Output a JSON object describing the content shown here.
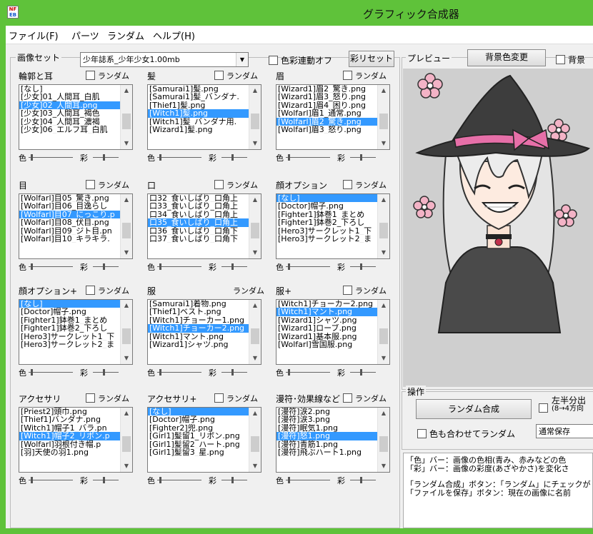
{
  "window": {
    "title": "グラフィック合成器"
  },
  "menu": {
    "items": [
      "ファイル(F)",
      "パーツ",
      "ランダム",
      "ヘルプ(H)"
    ]
  },
  "imageset": {
    "label": "画像セット",
    "value": "少年誌系_少年少女1.00mb",
    "color_link": "色彩連動オフ",
    "saturation_button": "彩リセット"
  },
  "preview": {
    "label": "プレビュー",
    "bgcolor_button": "背景色変更",
    "bg_check_label": "背景"
  },
  "parts": [
    {
      "name": "輪郭と耳",
      "random": "ランダム",
      "items": [
        "[なし]",
        "[少女]01_人間耳_白肌",
        "[少女]02_人間耳.png",
        "[少女]03_人間耳_褐色",
        "[少女]04_人間耳_濃褐",
        "[少女]06_エルフ耳_白肌"
      ],
      "selected": 2
    },
    {
      "name": "髪",
      "random": "ランダム",
      "items": [
        "[Samurai1]髪.png",
        "[Samurai1]髪_バンダナ.",
        "[Thief1]髪.png",
        "[Witch1]髪.png",
        "[Witch1]髪_バンダナ用.",
        "[Wizard1]髪.png"
      ],
      "selected": 3
    },
    {
      "name": "眉",
      "random": "ランダム",
      "items": [
        "[Wizard1]眉2_驚き.png",
        "[Wizard1]眉3_怒り.png",
        "[Wizard1]眉4_困り.png",
        "[Wolfarl]眉1_通常.png",
        "[Wolfarl]眉2_驚き.png",
        "[Wolfarl]眉3_怒り.png"
      ],
      "selected": 4
    },
    {
      "name": "目",
      "random": "ランダム",
      "items": [
        "[Wolfarl]目05_驚き.png",
        "[Wolfarl]目06_目逸らし",
        "[Wolfarl]目07_にっこり.p",
        "[Wolfarl]目08_伏目.png",
        "[Wolfarl]目09_ジト目.pn",
        "[Wolfarl]目10_キラキラ."
      ],
      "selected": 2
    },
    {
      "name": "口",
      "random": "ランダム",
      "items": [
        "口32_食いしばり_口角上",
        "口33_食いしばり_口角上",
        "口34_食いしばり_口角上",
        "口35_食いしばり_口角上",
        "口36_食いしばり_口角下",
        "口37_食いしばり_口角下"
      ],
      "selected": 3
    },
    {
      "name": "顔オプション",
      "random": "ランダム",
      "items": [
        "[なし]",
        "[Doctor]帽子.png",
        "[Fighter1]鉢巻1_まとめ",
        "[Fighter1]鉢巻2_下ろし",
        "[Hero3]サークレット1_下",
        "[Hero3]サークレット2_ま"
      ],
      "selected": 0
    },
    {
      "name": "顔オプション+",
      "random": "ランダム",
      "items": [
        "[なし]",
        "[Doctor]帽子.png",
        "[Fighter1]鉢巻1_まとめ",
        "[Fighter1]鉢巻2_下ろし",
        "[Hero3]サークレット1_下",
        "[Hero3]サークレット2_ま"
      ],
      "selected": 0
    },
    {
      "name": "服",
      "random": "ランダム",
      "items": [
        "[Samurai1]着物.png",
        "[Thief1]ベスト.png",
        "[Witch1]チョーカー1.png",
        "[Witch1]チョーカー2.png",
        "[Witch1]マント.png",
        "[Wizard1]シャツ.png"
      ],
      "selected": 3
    },
    {
      "name": "服+",
      "random": "ランダム",
      "items": [
        "[Witch1]チョーカー2.png",
        "[Witch1]マント.png",
        "[Wizard1]シャツ.png",
        "[Wizard1]ローブ.png",
        "[Wizard1]基本服.png",
        "[Wolfarl]雪国服.png"
      ],
      "selected": 1
    },
    {
      "name": "アクセサリ",
      "random": "ランダム",
      "items": [
        "[Priest2]頭巾.png",
        "[Thief1]バンダナ.png",
        "[Witch1]帽子1_バラ.pn",
        "[Witch1]帽子2_リボン.p",
        "[Wolfarl]羽根付き帽.p",
        "[羽]天使の羽1.png"
      ],
      "selected": 3
    },
    {
      "name": "アクセサリ+",
      "random": "ランダム",
      "items": [
        "[なし]",
        "[Doctor]帽子.png",
        "[Fighter2]兜.png",
        "[Girl1]髪留1_リボン.png",
        "[Girl1]髪留2_ハート.png",
        "[Girl1]髪留3_星.png"
      ],
      "selected": 0
    },
    {
      "name": "漫符･効果線など",
      "random": "ランダム",
      "items": [
        "[漫符]涙2.png",
        "[漫符]涙3.png",
        "[漫符]眠気1.png",
        "[漫符]怒1.png",
        "[漫符]青筋1.png",
        "[漫符]飛ぶハート1.png"
      ],
      "selected": 3
    }
  ],
  "slider": {
    "color": "色",
    "saturation": "彩"
  },
  "ops": {
    "label": "操作",
    "random_button": "ランダム合成",
    "color_random": "色も合わせてランダム",
    "split_label": "左半分出",
    "split_sub": "(8→4方向",
    "save_mode": "通常保存"
  },
  "help": [
    "「色」バー：画像の色相(青み、赤みなどの色",
    "「彩」バー：画像の彩度(あざやかさ)を変化さ",
    "",
    "「ランダム合成」ボタン：「ランダム」にチェックが",
    "「ファイルを保存」ボタン：現在の画像に名前"
  ],
  "colors": {
    "titlebar": "#5fc23a",
    "selection": "#3399ff",
    "preview_bg": "#cfcfcf"
  }
}
